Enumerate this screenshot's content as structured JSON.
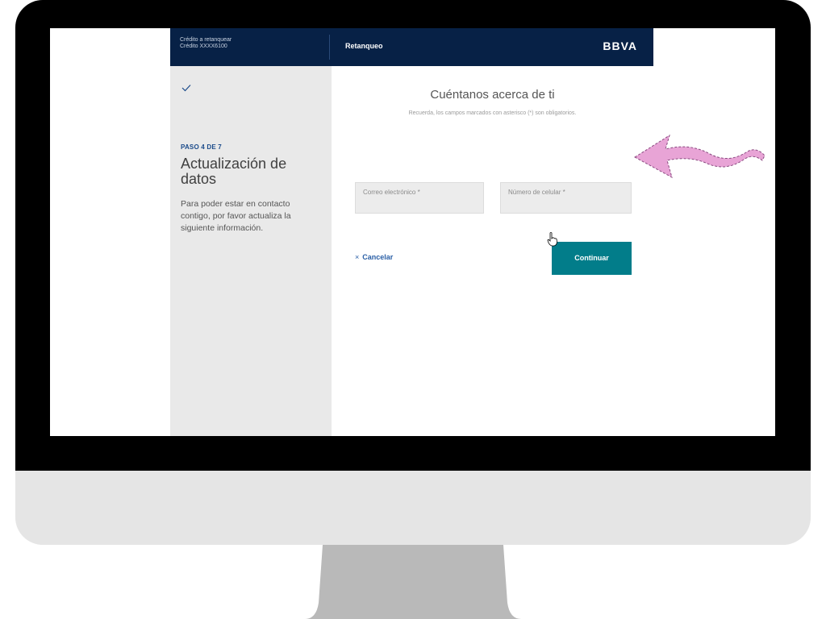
{
  "header": {
    "credit_label": "Crédito a retanquear",
    "credit_number": "Crédito XXXX6100",
    "title": "Retanqueo",
    "logo": "BBVA"
  },
  "side_panel": {
    "step": "PASO 4 DE 7",
    "title": "Actualización de datos",
    "description": "Para poder estar en contacto contigo, por favor actualiza la siguiente información."
  },
  "form": {
    "title": "Cuéntanos acerca de ti",
    "subtitle": "Recuerda, los campos marcados con asterisco (*) son obligatorios.",
    "email_placeholder": "Correo electrónico *",
    "phone_placeholder": "Número de celular *",
    "cancel_label": "Cancelar",
    "continue_label": "Continuar"
  },
  "colors": {
    "header_bg": "#072146",
    "button_bg": "#027d8a",
    "annotation_arrow": "#e8a4d6"
  },
  "icons": [
    "check-icon",
    "close-icon",
    "hand-cursor-icon",
    "annotation-arrow"
  ]
}
